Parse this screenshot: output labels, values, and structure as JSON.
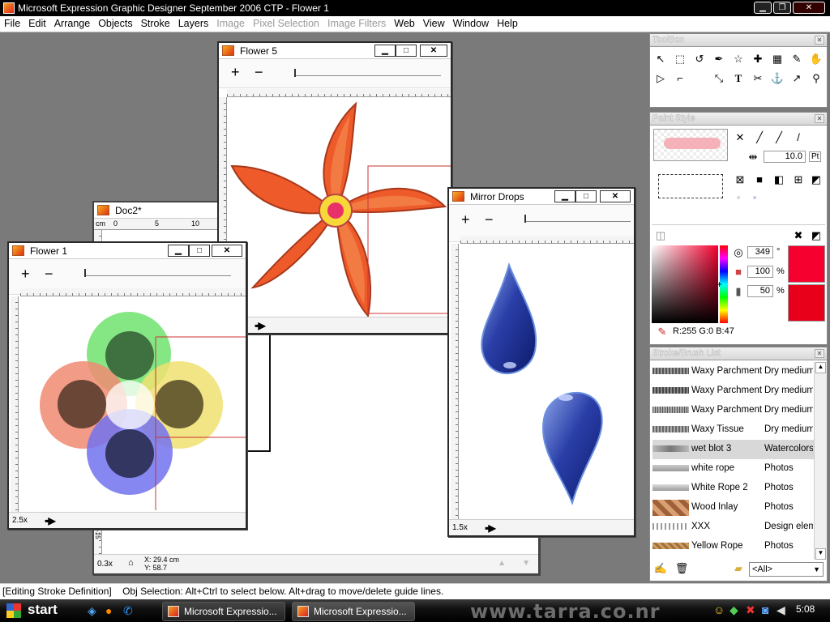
{
  "app": {
    "title": "Microsoft Expression Graphic Designer September 2006 CTP - Flower 1"
  },
  "menu": [
    "File",
    "Edit",
    "Arrange",
    "Objects",
    "Stroke",
    "Layers",
    "Image",
    "Pixel Selection",
    "Image Filters",
    "Web",
    "View",
    "Window",
    "Help"
  ],
  "menu_disabled": [
    "Image",
    "Pixel Selection",
    "Image Filters"
  ],
  "windows": {
    "flower5": {
      "title": "Flower 5"
    },
    "doc2": {
      "title": "Doc2*",
      "ruler_unit": "cm",
      "ruler_ticks": [
        "0",
        "5",
        "10"
      ],
      "zoom": "0.3x",
      "coords": "X: 29.4 cm\nY: 58.7",
      "v_ruler_label": "-15"
    },
    "flower1": {
      "title": "Flower 1",
      "zoom": "2.5x"
    },
    "mirror": {
      "title": "Mirror Drops",
      "zoom": "1.5x"
    }
  },
  "toolbox": {
    "title": "ToolBox"
  },
  "paint_style": {
    "title": "Paint Style",
    "width_value": "10.0",
    "width_unit": "Pt",
    "hue": "349",
    "hue_unit": "°",
    "sat": "100",
    "sat_unit": "%",
    "bri": "50",
    "bri_unit": "%",
    "rgb_readout": "R:255 G:0 B:47",
    "fill_color": "#f5002f"
  },
  "stroke_list": {
    "title": "Stroke/Brush List",
    "filter": "<All>",
    "items": [
      {
        "name": "Waxy Parchment",
        "category": "Dry medium"
      },
      {
        "name": "Waxy Parchment 2",
        "category": "Dry medium"
      },
      {
        "name": "Waxy Parchment 3",
        "category": "Dry medium"
      },
      {
        "name": "Waxy Tissue",
        "category": "Dry medium"
      },
      {
        "name": "wet blot 3",
        "category": "Watercolors",
        "selected": true
      },
      {
        "name": "white rope",
        "category": "Photos"
      },
      {
        "name": "White Rope 2",
        "category": "Photos"
      },
      {
        "name": "Wood Inlay",
        "category": "Photos"
      },
      {
        "name": "XXX",
        "category": "Design elem"
      },
      {
        "name": "Yellow Rope",
        "category": "Photos"
      }
    ]
  },
  "status": {
    "text": "[Editing Stroke Definition]    Obj Selection: Alt+Ctrl to select below. Alt+drag to move/delete guide lines."
  },
  "taskbar": {
    "start": "start",
    "tasks": [
      "Microsoft Expressio...",
      "Microsoft Expressio..."
    ],
    "watermark": "www.tarra.co.nr",
    "clock": "5:08"
  }
}
